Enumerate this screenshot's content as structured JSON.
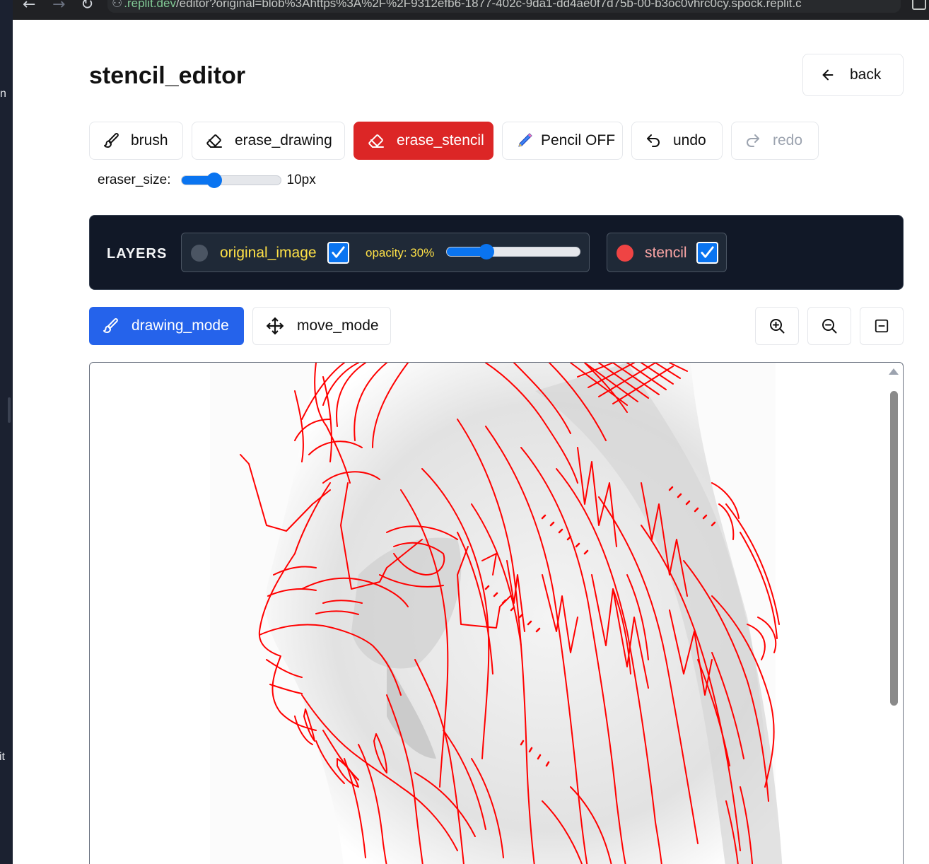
{
  "browser": {
    "url_host": ".replit.dev",
    "url_path": "/editor?original=blob%3Ahttps%3A%2F%2F9312efb6-1877-402c-9da1-dd4ae0f7d75b-00-b3oc0vhrc0cy.spock.replit.c"
  },
  "left_strip": {
    "top_text": "n",
    "bottom_text": "it"
  },
  "header": {
    "title": "stencil_editor",
    "back_label": "back"
  },
  "toolbar": {
    "brush_label": "brush",
    "erase_drawing_label": "erase_drawing",
    "erase_stencil_label": "erase_stencil",
    "pencil_label": "Pencil OFF",
    "undo_label": "undo",
    "redo_label": "redo",
    "active_tool": "erase_stencil"
  },
  "eraser": {
    "label": "eraser_size:",
    "value_text": "10px",
    "value_fraction": 0.33
  },
  "layers": {
    "title": "LAYERS",
    "original": {
      "label": "original_image",
      "checked": true,
      "opacity_label": "opacity: 30%",
      "opacity_fraction": 0.3,
      "color": "#4b5563"
    },
    "stencil": {
      "label": "stencil",
      "checked": true,
      "color": "#ef4444"
    }
  },
  "modes": {
    "drawing_label": "drawing_mode",
    "move_label": "move_mode",
    "active": "drawing_mode"
  },
  "zoom": {
    "in": "zoom-in-icon",
    "out": "zoom-out-icon",
    "fit": "fit-icon"
  },
  "colors": {
    "accent": "#2563eb",
    "danger": "#dc2626",
    "stencil_line": "#ff0000",
    "slider": "#0a74f0",
    "panel": "#111827"
  }
}
